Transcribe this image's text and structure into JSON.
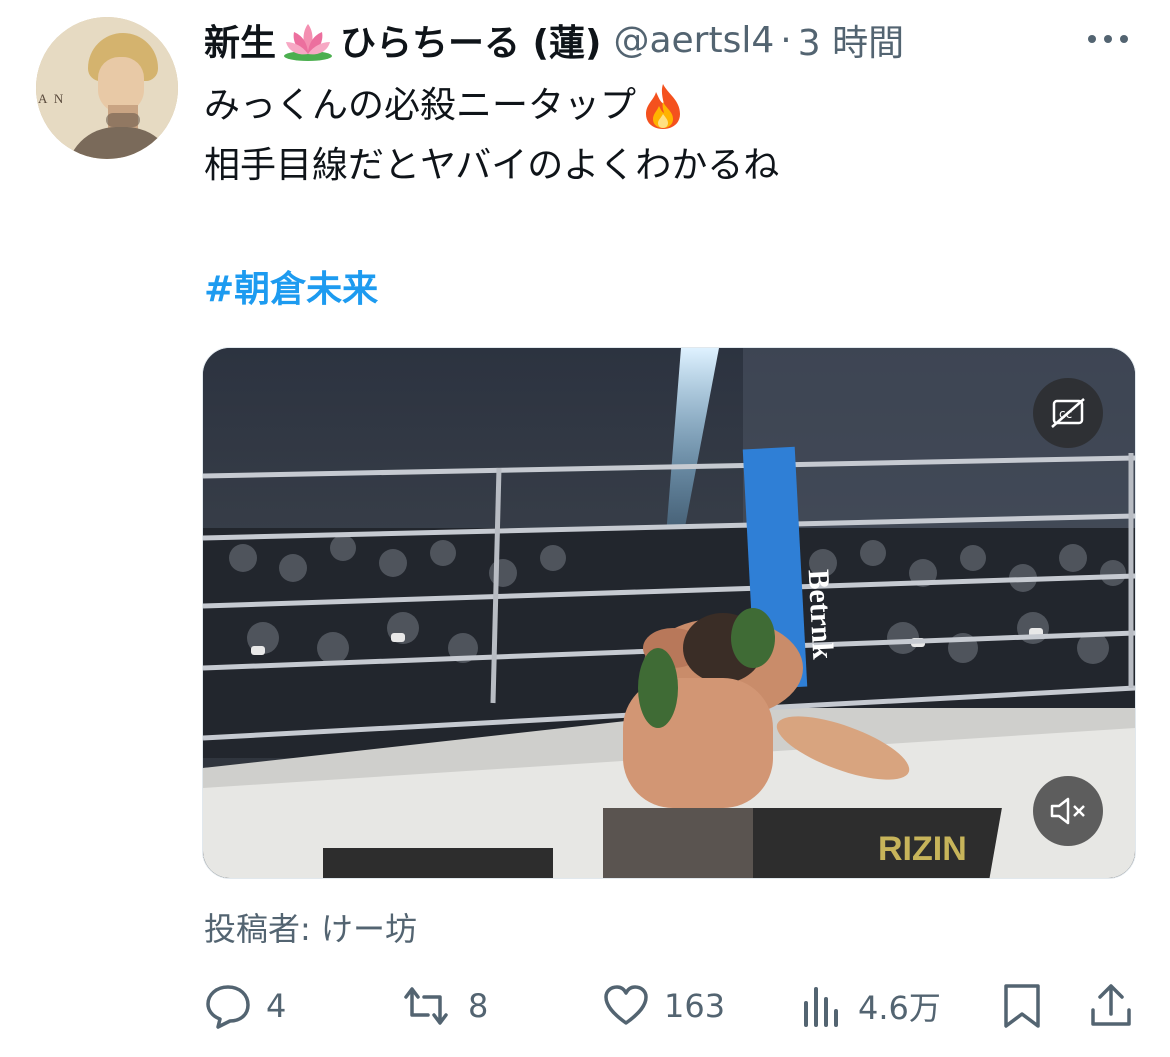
{
  "tweet": {
    "display_name": "新生",
    "display_name_rest": "ひらちーる (蓮)",
    "name_emoji": "lotus-icon",
    "handle": "@aertsl4",
    "separator": "·",
    "time": "3 時間",
    "text_line1": "みっくんの必殺ニータップ",
    "text_line1_emoji": "fire-icon",
    "text_line2": "相手目線だとヤバイのよくわかるね",
    "hashtag": "#朝倉未来",
    "author_credit": "投稿者: けー坊"
  },
  "video": {
    "banner_text": "Betrnk",
    "mat_logo": "RIZIN"
  },
  "actions": {
    "reply_count": "4",
    "retweet_count": "8",
    "like_count": "163",
    "views_count": "4.6万"
  },
  "colors": {
    "text": "#0f1419",
    "secondary": "#536471",
    "accent": "#1d9bf0"
  }
}
